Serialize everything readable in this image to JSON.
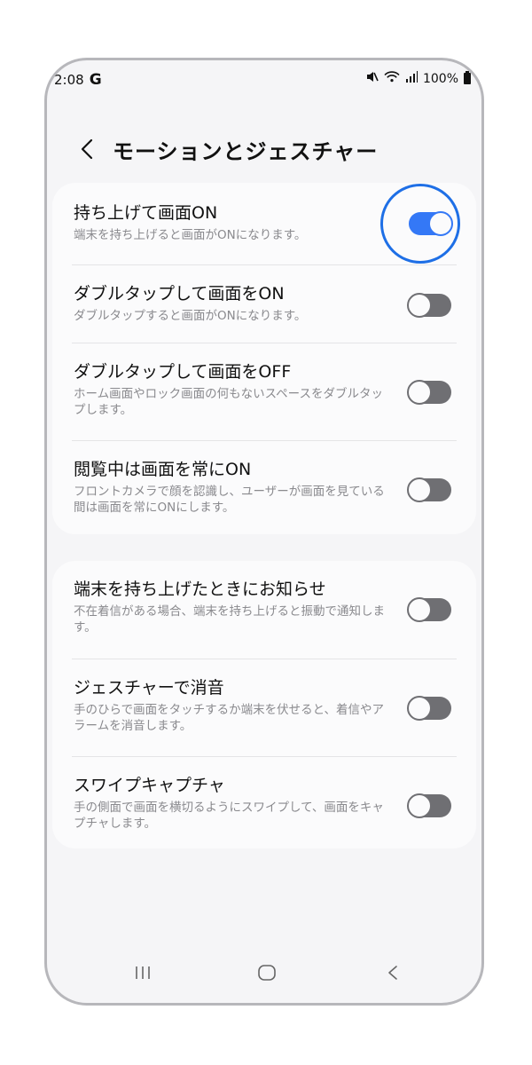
{
  "status_bar": {
    "time": "2:08",
    "g_label": "G",
    "battery": "100%"
  },
  "header": {
    "title": "モーションとジェスチャー"
  },
  "group1": [
    {
      "title": "持ち上げて画面ON",
      "desc": "端末を持ち上げると画面がONになります。",
      "on": true
    },
    {
      "title": "ダブルタップして画面をON",
      "desc": "ダブルタップすると画面がONになります。",
      "on": false
    },
    {
      "title": "ダブルタップして画面をOFF",
      "desc": "ホーム画面やロック画面の何もないスペースをダブルタップします。",
      "on": false
    },
    {
      "title": "閲覧中は画面を常にON",
      "desc": "フロントカメラで顔を認識し、ユーザーが画面を見ている間は画面を常にONにします。",
      "on": false
    }
  ],
  "group2": [
    {
      "title": "端末を持ち上げたときにお知らせ",
      "desc": "不在着信がある場合、端末を持ち上げると振動で通知します。",
      "on": false
    },
    {
      "title": "ジェスチャーで消音",
      "desc": "手のひらで画面をタッチするか端末を伏せると、着信やアラームを消音します。",
      "on": false
    },
    {
      "title": "スワイプキャプチャ",
      "desc": "手の側面で画面を横切るようにスワイプして、画面をキャプチャします。",
      "on": false
    }
  ],
  "colors": {
    "accent": "#3478f6",
    "highlight": "#1e6fe6",
    "toggle_off": "#6f6f73"
  },
  "icons": {
    "back": "chevron-left-icon",
    "nav_recent": "recent-apps-icon",
    "nav_home": "home-icon",
    "nav_back": "back-icon"
  }
}
